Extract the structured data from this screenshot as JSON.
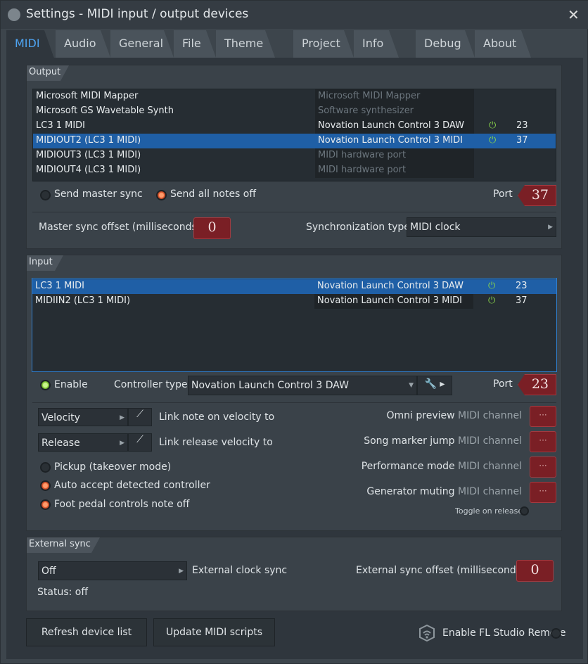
{
  "window": {
    "title": "Settings - MIDI input / output devices",
    "close": "✕"
  },
  "tabs": [
    {
      "label": "MIDI"
    },
    {
      "label": "Audio"
    },
    {
      "label": "General"
    },
    {
      "label": "File"
    },
    {
      "label": "Theme"
    },
    {
      "label": "Project"
    },
    {
      "label": "Info"
    },
    {
      "label": "Debug"
    },
    {
      "label": "About"
    }
  ],
  "output": {
    "header": "Output",
    "devices": [
      {
        "name": "Microsoft MIDI Mapper",
        "controller": "Microsoft MIDI Mapper",
        "enabled": false,
        "port": ""
      },
      {
        "name": "Microsoft GS Wavetable Synth",
        "controller": "Software synthesizer",
        "enabled": false,
        "port": ""
      },
      {
        "name": "LC3 1 MIDI",
        "controller": "Novation Launch Control 3 DAW",
        "enabled": true,
        "port": "23"
      },
      {
        "name": "MIDIOUT2 (LC3 1 MIDI)",
        "controller": "Novation Launch Control 3 MIDI",
        "enabled": true,
        "port": "37"
      },
      {
        "name": "MIDIOUT3 (LC3 1 MIDI)",
        "controller": "MIDI hardware port",
        "enabled": false,
        "port": ""
      },
      {
        "name": "MIDIOUT4 (LC3 1 MIDI)",
        "controller": "MIDI hardware port",
        "enabled": false,
        "port": ""
      }
    ],
    "send_master_sync": "Send master sync",
    "send_all_notes_off": "Send all notes off",
    "port_label": "Port",
    "port_value": "37",
    "master_sync_offset_label": "Master sync offset (milliseconds)",
    "master_sync_offset_value": "0",
    "sync_type_label": "Synchronization type",
    "sync_type_value": "MIDI clock"
  },
  "input": {
    "header": "Input",
    "devices": [
      {
        "name": "LC3 1 MIDI",
        "controller": "Novation Launch Control 3 DAW",
        "port": "23"
      },
      {
        "name": "MIDIIN2 (LC3 1 MIDI)",
        "controller": "Novation Launch Control 3 MIDI",
        "port": "37"
      }
    ],
    "enable_label": "Enable",
    "controller_type_label": "Controller type",
    "controller_type_value": "Novation Launch Control 3 DAW",
    "port_label": "Port",
    "port_value": "23",
    "velocity_combo": "Velocity",
    "velocity_link_label": "Link note on velocity to",
    "release_combo": "Release",
    "release_link_label": "Link release velocity to",
    "pickup_label": "Pickup (takeover mode)",
    "auto_accept_label": "Auto accept detected controller",
    "foot_pedal_label": "Foot pedal controls note off",
    "midi_channel_word": "MIDI channel",
    "omni_preview": "Omni preview",
    "song_marker_jump": "Song marker jump",
    "performance_mode": "Performance mode",
    "generator_muting": "Generator muting",
    "channel_value": "···",
    "toggle_on_release": "Toggle on release"
  },
  "external_sync": {
    "header": "External sync",
    "mode_value": "Off",
    "clock_sync_label": "External clock sync",
    "offset_label": "External sync offset (milliseconds)",
    "offset_value": "0",
    "status": "Status: off"
  },
  "footer": {
    "refresh_button": "Refresh device list",
    "update_scripts_button": "Update MIDI scripts",
    "enable_remote_label": "Enable FL Studio Remote"
  },
  "colors": {
    "accent_blue": "#1f5fa6",
    "lcd_red": "#7a1f25",
    "power_green": "#88d34a",
    "radio_orange": "#e05c33"
  }
}
